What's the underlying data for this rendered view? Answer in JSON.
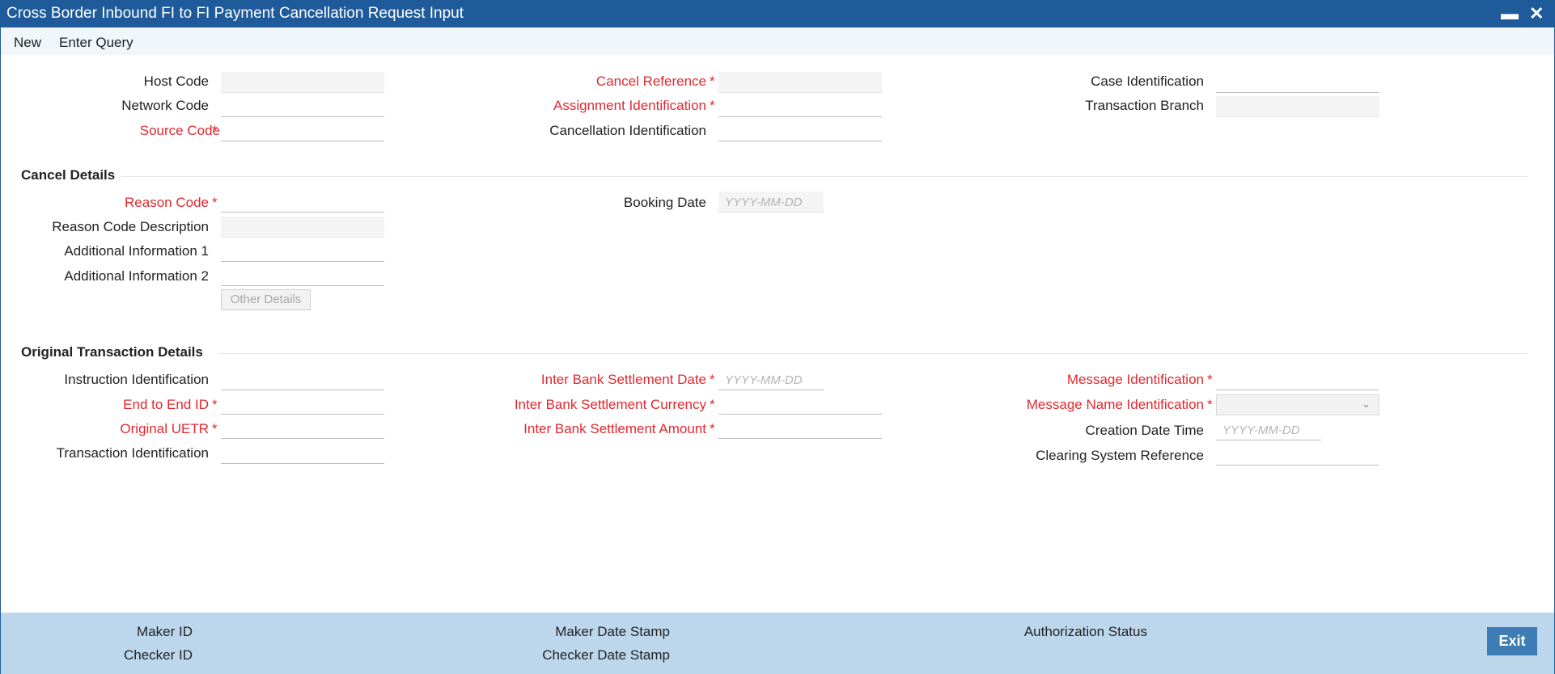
{
  "window": {
    "title": "Cross Border Inbound FI to FI Payment Cancellation Request Input"
  },
  "toolbar": {
    "new_label": "New",
    "enter_query_label": "Enter Query"
  },
  "header_fields": {
    "host_code": "Host Code",
    "network_code": "Network Code",
    "source_code": "Source Code",
    "cancel_reference": "Cancel Reference",
    "assignment_identification": "Assignment Identification",
    "cancellation_identification": "Cancellation Identification",
    "case_identification": "Case Identification",
    "transaction_branch": "Transaction Branch"
  },
  "cancel_details": {
    "title": "Cancel Details",
    "reason_code": "Reason Code",
    "reason_code_description": "Reason Code Description",
    "additional_information_1": "Additional Information 1",
    "additional_information_2": "Additional Information 2",
    "other_details_button": "Other Details",
    "booking_date": "Booking Date",
    "booking_date_placeholder": "YYYY-MM-DD"
  },
  "original_transaction": {
    "title": "Original Transaction Details",
    "instruction_identification": "Instruction Identification",
    "end_to_end_id": "End to End ID",
    "original_uetr": "Original UETR",
    "transaction_identification": "Transaction Identification",
    "inter_bank_settlement_date": "Inter Bank Settlement Date",
    "inter_bank_settlement_date_placeholder": "YYYY-MM-DD",
    "inter_bank_settlement_currency": "Inter Bank Settlement Currency",
    "inter_bank_settlement_amount": "Inter Bank Settlement Amount",
    "message_identification": "Message Identification",
    "message_name_identification": "Message Name Identification",
    "creation_date_time": "Creation Date Time",
    "creation_date_time_placeholder": "YYYY-MM-DD",
    "clearing_system_reference": "Clearing System Reference"
  },
  "required_marker": "*",
  "footer": {
    "maker_id": "Maker ID",
    "checker_id": "Checker ID",
    "maker_date_stamp": "Maker Date Stamp",
    "checker_date_stamp": "Checker Date Stamp",
    "authorization_status": "Authorization Status",
    "exit_label": "Exit"
  },
  "colors": {
    "title_bar": "#1f5b9a",
    "required_label": "#e0292f",
    "footer_background": "#bcd7ec",
    "exit_button": "#3d7cb5"
  },
  "icons": [
    "minimize-icon",
    "close-icon",
    "chevron-down-icon"
  ]
}
